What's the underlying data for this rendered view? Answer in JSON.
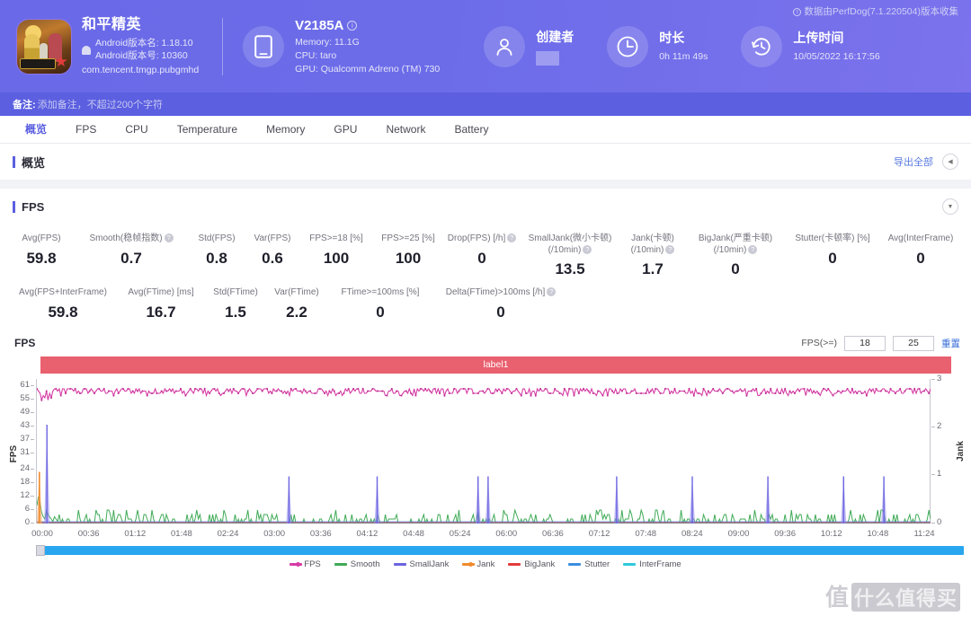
{
  "header": {
    "perfdog_note": "数据由PerfDog(7.1.220504)版本收集",
    "app": {
      "name": "和平精英",
      "android_version_name": "Android版本名: 1.18.10",
      "android_version_code": "Android版本号: 10360",
      "package": "com.tencent.tmgp.pubgmhd"
    },
    "device": {
      "model": "V2185A",
      "memory": "Memory: 11.1G",
      "cpu": "CPU: taro",
      "gpu": "GPU: Qualcomm Adreno (TM) 730"
    },
    "creator": {
      "title": "创建者",
      "value": ""
    },
    "duration": {
      "title": "时长",
      "value": "0h 11m 49s"
    },
    "upload": {
      "title": "上传时间",
      "value": "10/05/2022 16:17:56"
    }
  },
  "notebar": {
    "label": "备注:",
    "placeholder": "添加备注，不超过200个字符"
  },
  "tabs": [
    {
      "label": "概览",
      "active": true
    },
    {
      "label": "FPS",
      "active": false
    },
    {
      "label": "CPU",
      "active": false
    },
    {
      "label": "Temperature",
      "active": false
    },
    {
      "label": "Memory",
      "active": false
    },
    {
      "label": "GPU",
      "active": false
    },
    {
      "label": "Network",
      "active": false
    },
    {
      "label": "Battery",
      "active": false
    }
  ],
  "overview_section": {
    "title": "概览",
    "export_label": "导出全部",
    "collapse_icon": "chevron-left-icon"
  },
  "fps_section": {
    "title": "FPS",
    "expand_icon": "chevron-down-icon"
  },
  "metrics": {
    "row1": [
      {
        "label": "Avg(FPS)",
        "value": "59.8",
        "help": false
      },
      {
        "label": "Smooth(稳帧指数)",
        "value": "0.7",
        "help": true
      },
      {
        "label": "Std(FPS)",
        "value": "0.8",
        "help": false
      },
      {
        "label": "Var(FPS)",
        "value": "0.6",
        "help": false
      },
      {
        "label": "FPS>=18 [%]",
        "value": "100",
        "help": false
      },
      {
        "label": "FPS>=25 [%]",
        "value": "100",
        "help": false
      },
      {
        "label": "Drop(FPS) [/h]",
        "value": "0",
        "help": true
      },
      {
        "label": "SmallJank(微小卡顿)\n(/10min)",
        "value": "13.5",
        "help": true
      },
      {
        "label": "Jank(卡顿)\n(/10min)",
        "value": "1.7",
        "help": true
      },
      {
        "label": "BigJank(严重卡顿)\n(/10min)",
        "value": "0",
        "help": true
      },
      {
        "label": "Stutter(卡顿率) [%]",
        "value": "0",
        "help": false
      },
      {
        "label": "Avg(InterFrame)",
        "value": "0",
        "help": false
      }
    ],
    "row2": [
      {
        "label": "Avg(FPS+InterFrame)",
        "value": "59.8",
        "help": false
      },
      {
        "label": "Avg(FTime) [ms]",
        "value": "16.7",
        "help": false
      },
      {
        "label": "Std(FTime)",
        "value": "1.5",
        "help": false
      },
      {
        "label": "Var(FTime)",
        "value": "2.2",
        "help": false
      },
      {
        "label": "FTime>=100ms [%]",
        "value": "0",
        "help": false
      },
      {
        "label": "Delta(FTime)>100ms [/h]",
        "value": "0",
        "help": true
      }
    ]
  },
  "chart_controls": {
    "chart_title": "FPS",
    "threshold_label": "FPS(>=)",
    "threshold_1": "18",
    "threshold_2": "25",
    "reset_label": "重置",
    "band_label": "label1"
  },
  "watermark": {
    "text": "值",
    "tag": "什么值得买"
  },
  "chart_data": {
    "type": "line",
    "title": "FPS",
    "xlabel": "",
    "ylabel": "FPS",
    "y2label": "Jank",
    "ylim": [
      0,
      64
    ],
    "y2lim": [
      0,
      3
    ],
    "yticks": [
      0,
      6,
      12,
      18,
      24,
      31,
      37,
      43,
      49,
      55,
      61
    ],
    "y2ticks": [
      0,
      1,
      2,
      3
    ],
    "xtick_labels": [
      "00:00",
      "00:36",
      "01:12",
      "01:48",
      "02:24",
      "03:00",
      "03:36",
      "04:12",
      "04:48",
      "05:24",
      "06:00",
      "06:36",
      "07:12",
      "07:48",
      "08:24",
      "09:00",
      "09:36",
      "10:12",
      "10:48",
      "11:24"
    ],
    "x_range_seconds": [
      0,
      709
    ],
    "grid": false,
    "legend_position": "bottom",
    "legend": [
      {
        "name": "FPS",
        "color": "#d63ca5",
        "marker": "square-line"
      },
      {
        "name": "Smooth",
        "color": "#3faa56",
        "marker": "line"
      },
      {
        "name": "SmallJank",
        "color": "#6b63e0",
        "marker": "line"
      },
      {
        "name": "Jank",
        "color": "#f08a2c",
        "marker": "square-line"
      },
      {
        "name": "BigJank",
        "color": "#e33b3b",
        "marker": "line"
      },
      {
        "name": "Stutter",
        "color": "#3b8ee0",
        "marker": "line"
      },
      {
        "name": "InterFrame",
        "color": "#2ec9dd",
        "marker": "line"
      }
    ],
    "series": [
      {
        "name": "FPS",
        "color": "#d63ca5",
        "axis": "left",
        "description": "Frame rate holds steady between 57 and 61 fps for the whole 11m49s capture, with two dips to ~55 near the very start.",
        "sample_values": [
          60,
          59,
          58,
          55,
          57,
          60,
          59,
          58,
          55,
          58,
          60,
          59,
          60,
          58,
          59,
          60,
          59,
          60,
          58,
          60,
          59,
          60,
          59,
          58,
          60,
          59,
          60,
          58,
          59,
          60,
          59,
          58,
          60,
          59,
          60,
          59,
          58,
          60,
          59,
          60,
          59,
          58,
          60,
          59,
          60,
          58,
          59,
          60,
          59,
          60,
          58,
          59,
          60,
          59,
          58,
          60,
          59,
          60,
          58,
          59,
          60,
          59,
          60,
          58,
          59,
          60,
          59,
          58,
          60,
          59,
          60,
          59,
          58,
          60,
          59,
          60,
          58,
          59,
          60,
          59,
          58,
          60,
          59,
          60,
          59,
          58,
          57,
          59,
          60,
          58,
          59,
          60,
          59,
          58,
          60,
          59,
          60,
          58,
          59,
          60
        ]
      },
      {
        "name": "Smooth",
        "color": "#3faa56",
        "axis": "left",
        "description": "Small green ripples hugging the baseline, oscillating between 0 and ~4 with occasional bumps to ~6.",
        "sample_values": [
          0,
          1,
          0,
          2,
          0,
          1,
          0,
          3,
          1,
          0,
          2,
          0,
          1,
          3,
          0,
          1,
          0,
          2,
          1,
          0,
          3,
          1,
          0,
          2,
          0,
          1,
          0,
          3,
          1,
          0,
          2,
          1,
          0,
          1,
          3,
          0,
          1,
          2,
          0,
          1,
          0,
          3,
          1,
          0,
          2,
          0,
          1,
          3,
          0,
          1,
          2,
          0,
          1,
          0,
          3,
          1,
          0,
          2,
          1,
          0,
          1,
          3,
          0,
          2,
          0,
          1,
          0,
          3,
          1,
          0,
          2,
          1,
          0,
          3,
          0,
          1,
          2,
          0,
          1,
          0,
          3,
          1,
          0,
          2,
          0,
          1,
          3,
          0,
          1,
          2,
          0,
          1,
          0,
          3,
          1,
          0,
          2,
          0,
          1,
          0
        ]
      },
      {
        "name": "SmallJank",
        "color": "#6b63e0",
        "axis": "right",
        "description": "Sparse tall spikes; one very tall spike near 00:08 reaching ~44 on the FPS axis, plus ~10 shorter spikes (~21) spread across the timeline near 03:20, 04:30, 05:50, 06:00, 07:40, 08:40, 09:40, 10:20, 11:00.",
        "spike_positions_seconds": [
          8,
          200,
          270,
          350,
          358,
          460,
          520,
          580,
          640,
          672
        ],
        "spike_heights": [
          44,
          21,
          21,
          21,
          21,
          21,
          21,
          21,
          21,
          21
        ]
      },
      {
        "name": "Jank",
        "color": "#f08a2c",
        "axis": "right",
        "description": "A single orange spike at the very beginning (~00:02) reaching ~23, otherwise flat at 0.",
        "spike_positions_seconds": [
          2
        ],
        "spike_heights": [
          23
        ]
      },
      {
        "name": "BigJank",
        "color": "#e33b3b",
        "axis": "right",
        "description": "Flat at 0 across the entire capture.",
        "sample_values": [
          0
        ]
      },
      {
        "name": "Stutter",
        "color": "#3b8ee0",
        "axis": "right",
        "description": "Flat at 0 across the entire capture.",
        "sample_values": [
          0
        ]
      },
      {
        "name": "InterFrame",
        "color": "#2ec9dd",
        "axis": "right",
        "description": "Flat at 0 across the entire capture.",
        "sample_values": [
          0
        ]
      }
    ]
  }
}
